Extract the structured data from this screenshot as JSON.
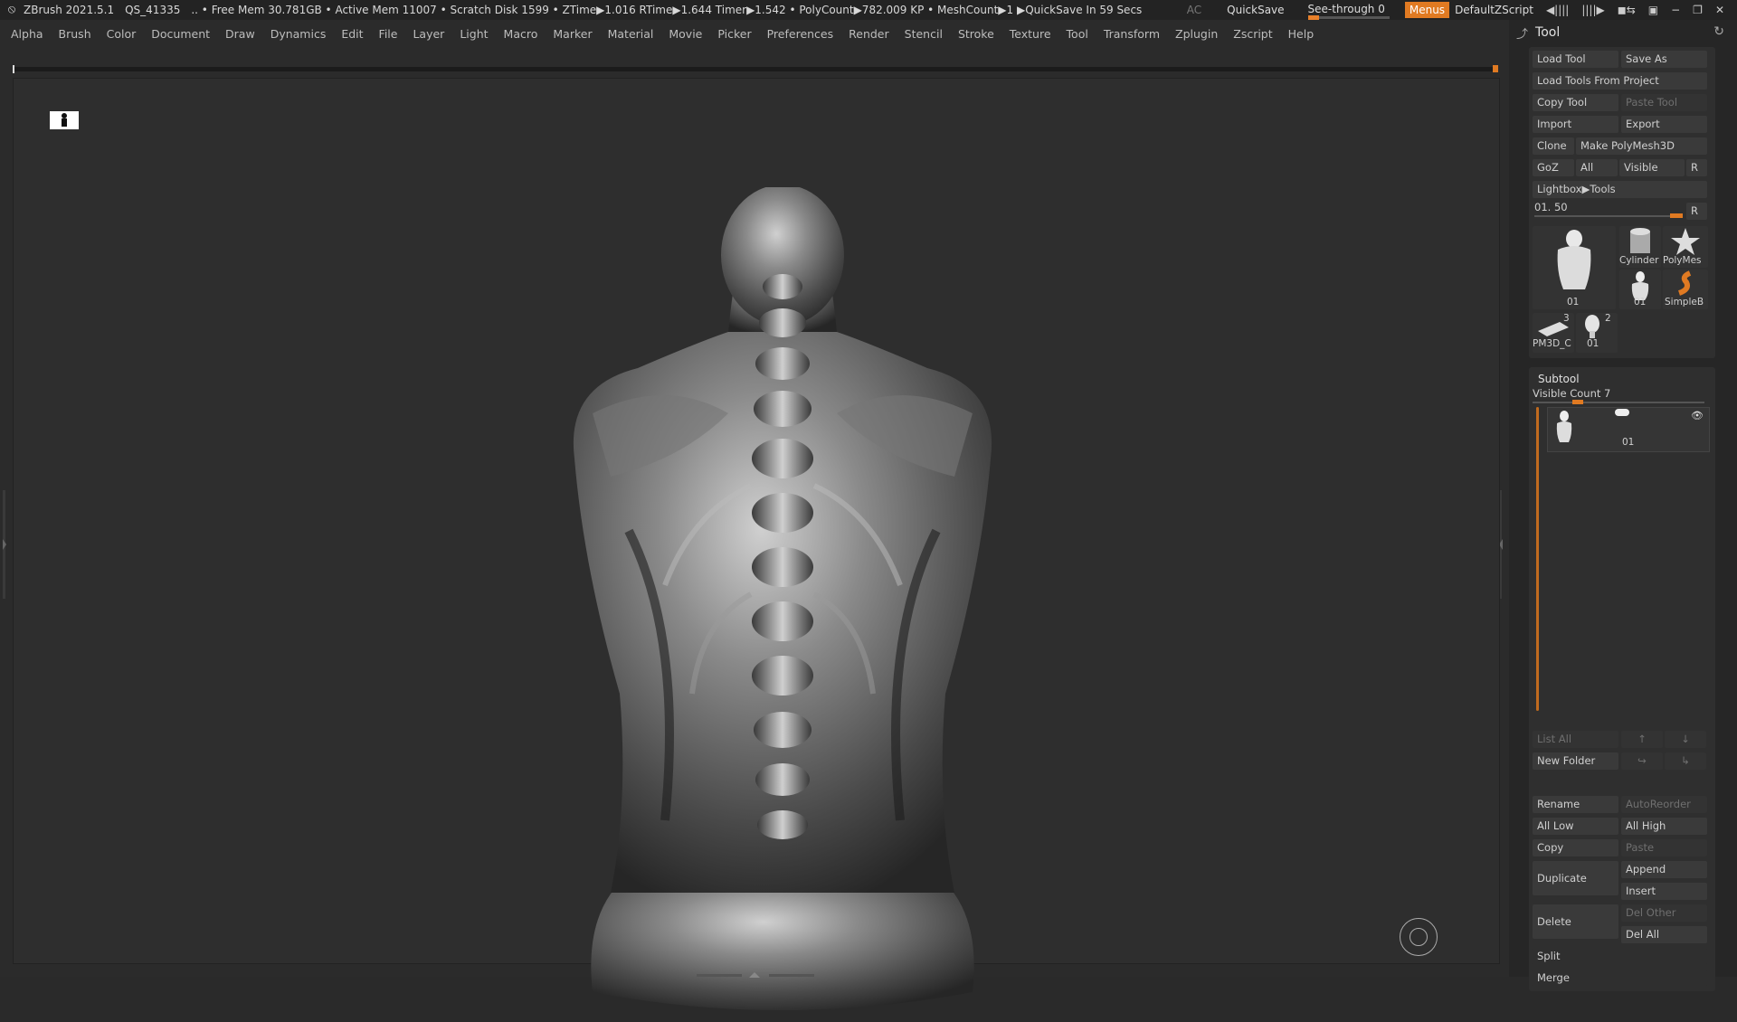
{
  "titlebar": {
    "app": "ZBrush 2021.5.1",
    "session": "QS_41335",
    "stats": ".. • Free Mem 30.781GB • Active Mem 11007 • Scratch Disk 1599 •  ZTime▶1.016 RTime▶1.644 Timer▶1.542 • PolyCount▶782.009 KP  • MeshCount▶1  ▶QuickSave In 59 Secs",
    "ac": "AC",
    "quicksave": "QuickSave",
    "seethrough": "See-through  0",
    "menus": "Menus",
    "script": "DefaultZScript"
  },
  "menubar": {
    "items": [
      "Alpha",
      "Brush",
      "Color",
      "Document",
      "Draw",
      "Dynamics",
      "Edit",
      "File",
      "Layer",
      "Light",
      "Macro",
      "Marker",
      "Material",
      "Movie",
      "Picker",
      "Preferences",
      "Render",
      "Stencil",
      "Stroke",
      "Texture",
      "Tool",
      "Transform",
      "Zplugin",
      "Zscript",
      "Help"
    ]
  },
  "panel": {
    "title": "Tool",
    "buttons": {
      "load_tool": "Load Tool",
      "save_as": "Save As",
      "load_from_project": "Load Tools From Project",
      "copy_tool": "Copy Tool",
      "paste_tool": "Paste Tool",
      "import": "Import",
      "export": "Export",
      "clone": "Clone",
      "make_polymesh": "Make PolyMesh3D",
      "goz": "GoZ",
      "all": "All",
      "visible": "Visible",
      "r": "R",
      "lightbox_tools": "Lightbox▶Tools",
      "slider_value": "01. 50",
      "slider_r": "R"
    },
    "thumbs": {
      "main": "01",
      "cylinder": "Cylinder",
      "polymesh": "PolyMes",
      "small01": "01",
      "simpleb": "SimpleB",
      "pm3d": "PM3D_C",
      "pm3d_count": "3",
      "head01": "01",
      "head_count": "2"
    },
    "subtool": {
      "title": "Subtool",
      "visible_count": "Visible Count 7",
      "item_name": "01",
      "list_all": "List All",
      "new_folder": "New Folder",
      "rename": "Rename",
      "auto_reorder": "AutoReorder",
      "all_low": "All Low",
      "all_high": "All High",
      "copy": "Copy",
      "paste": "Paste",
      "duplicate": "Duplicate",
      "append": "Append",
      "insert": "Insert",
      "delete": "Delete",
      "del_other": "Del Other",
      "del_all": "Del All",
      "split": "Split",
      "merge": "Merge"
    }
  },
  "colors": {
    "accent": "#e07a22",
    "background": "#2e2e2e",
    "panel": "#262626"
  }
}
